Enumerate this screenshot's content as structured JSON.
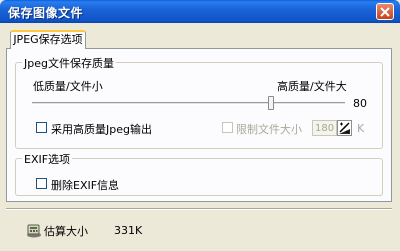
{
  "window": {
    "title": "保存图像文件"
  },
  "tabs": [
    {
      "label": "JPEG保存选项",
      "active": true
    }
  ],
  "quality_group": {
    "legend": "Jpeg文件保存质量",
    "low_label": "低质量/文件小",
    "high_label": "高质量/文件大",
    "slider_value": 80,
    "slider_value_text": "80",
    "high_quality_checkbox_label": "采用高质量Jpeg输出",
    "high_quality_checked": false,
    "limit_size_checkbox_label": "限制文件大小",
    "limit_size_checked": false,
    "limit_size_value": "180",
    "limit_size_unit": "K"
  },
  "exif_group": {
    "legend": "EXIF选项",
    "remove_exif_label": "删除EXIF信息",
    "remove_exif_checked": false
  },
  "status": {
    "estimate_label": "估算大小",
    "estimate_value": "331K"
  },
  "icons": {
    "close": "close-icon",
    "calc": "calculator-icon",
    "spin": "slider-spin-icon"
  },
  "colors": {
    "titlebar": "#0f55c9",
    "dialog_bg": "#ece9d8",
    "tab_accent": "#ffc83c"
  }
}
